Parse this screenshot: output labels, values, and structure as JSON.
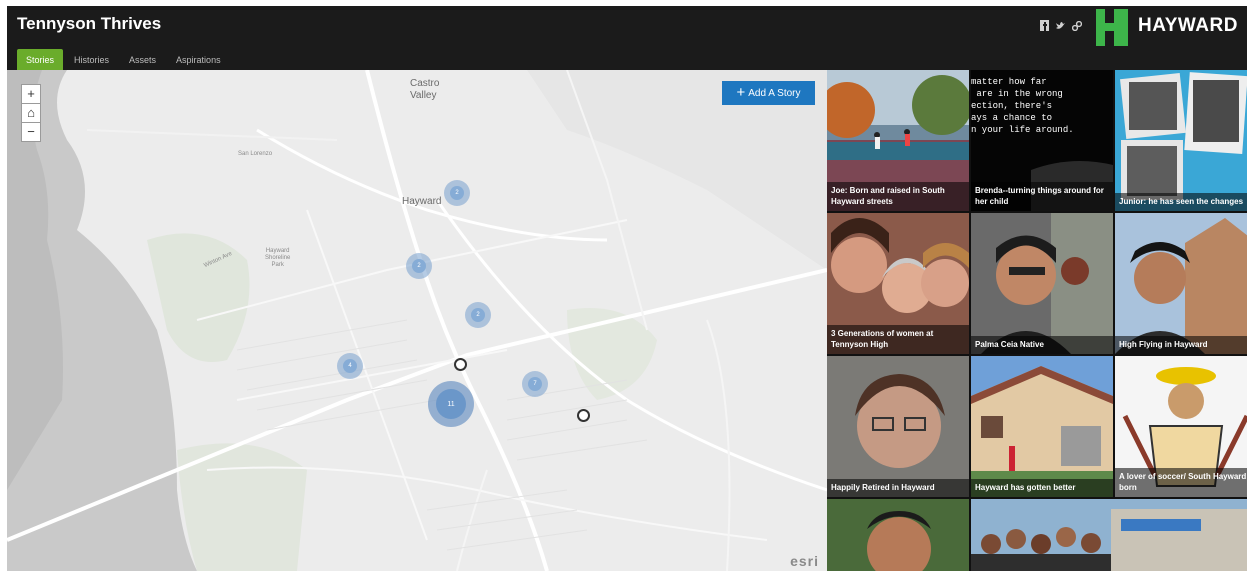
{
  "header": {
    "title": "Tennyson Thrives",
    "logo_text": "HAYWARD",
    "social_icons": [
      "facebook-icon",
      "twitter-icon",
      "link-icon"
    ]
  },
  "tabs": [
    {
      "label": "Stories",
      "active": true
    },
    {
      "label": "Histories",
      "active": false
    },
    {
      "label": "Assets",
      "active": false
    },
    {
      "label": "Aspirations",
      "active": false
    }
  ],
  "map": {
    "zoom_in": "+",
    "home": "⌂",
    "zoom_out": "−",
    "add_story_label": "Add A Story",
    "places": {
      "castro_valley": "Castro\nValley",
      "hayward": "Hayward",
      "san_lorenzo": "San Lorenzo",
      "hayward_shoreline": "Hayward\nShoreline\nPark",
      "road_label": "Winton Ave"
    },
    "clusters": [
      "2",
      "2",
      "2",
      "4",
      "7",
      "11"
    ],
    "attribution": "esri"
  },
  "stories": [
    {
      "caption": "Joe: Born and raised in South Hayward streets"
    },
    {
      "caption": "Brenda--turning things around for her child",
      "quote": "matter how far\n are in the wrong\nection, there's\nays a chance to\nn your life around."
    },
    {
      "caption": "Junior: he has seen the changes"
    },
    {
      "caption": "3 Generations of women at Tennyson High"
    },
    {
      "caption": "Palma Ceia Native"
    },
    {
      "caption": "High Flying in Hayward"
    },
    {
      "caption": "Happily Retired in Hayward"
    },
    {
      "caption": "Hayward has gotten better"
    },
    {
      "caption": "A lover of soccer/ South Hayward born"
    },
    {
      "caption": ""
    },
    {
      "caption": ""
    }
  ],
  "colors": {
    "accent": "#6aac2b",
    "brand_green": "#3db54a",
    "button_blue": "#1e77c0",
    "header_bg": "#1b1b1b"
  }
}
